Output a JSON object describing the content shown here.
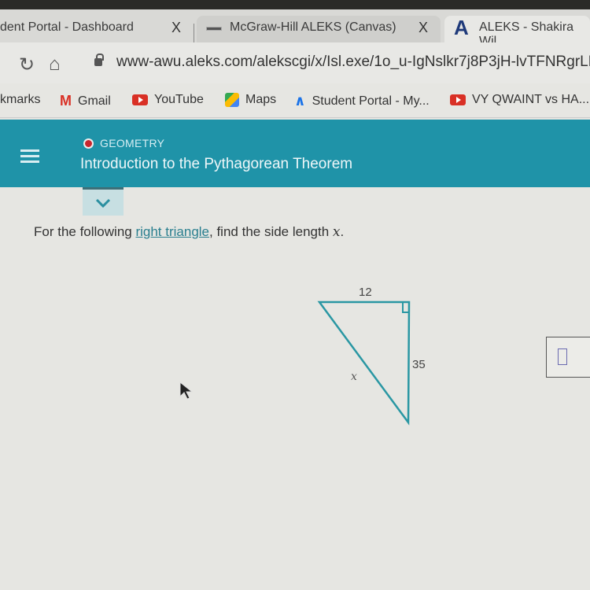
{
  "browser": {
    "tabs": [
      {
        "label": "dent Portal - Dashboard",
        "close": "X"
      },
      {
        "label": "McGraw-Hill ALEKS (Canvas)",
        "close": "X"
      },
      {
        "label": "ALEKS - Shakira Wil",
        "favicon": "A"
      }
    ],
    "url": "www-awu.aleks.com/alekscgi/x/Isl.exe/1o_u-IgNslkr7j8P3jH-lvTFNRgrLR",
    "bookmarks": [
      {
        "label": "kmarks"
      },
      {
        "label": "Gmail",
        "icon": "M"
      },
      {
        "label": "YouTube"
      },
      {
        "label": "Maps"
      },
      {
        "label": "Student Portal - My..."
      },
      {
        "label": "VY QWAINT vs HA..."
      }
    ]
  },
  "header": {
    "subject": "GEOMETRY",
    "title": "Introduction to the Pythagorean Theorem",
    "accent_color": "#1f93a8",
    "subject_dot_color": "#c8262e"
  },
  "question": {
    "prefix": "For the following ",
    "link": "right triangle",
    "suffix": ", find the side length ",
    "variable": "x",
    "end": "."
  },
  "figure": {
    "top_side_label": "12",
    "right_side_label": "35",
    "hypotenuse_label": "x",
    "stroke_color": "#2a97a3"
  }
}
